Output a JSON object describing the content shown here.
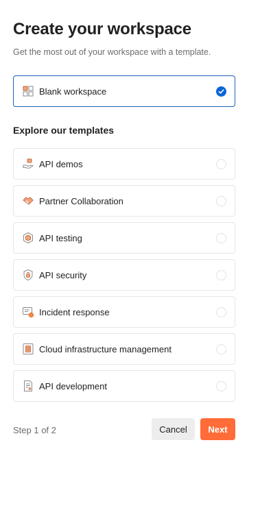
{
  "header": {
    "title": "Create your workspace",
    "subtitle": "Get the most out of your workspace with a template."
  },
  "blank": {
    "label": "Blank workspace",
    "selected": true,
    "icon": "blank-grid-icon"
  },
  "templates": {
    "heading": "Explore our templates",
    "items": [
      {
        "label": "API demos",
        "icon": "hand-box-icon"
      },
      {
        "label": "Partner Collaboration",
        "icon": "handshake-icon"
      },
      {
        "label": "API testing",
        "icon": "hexagon-badge-icon"
      },
      {
        "label": "API security",
        "icon": "shield-lock-icon"
      },
      {
        "label": "Incident response",
        "icon": "alert-message-icon"
      },
      {
        "label": "Cloud infrastructure management",
        "icon": "server-rack-icon"
      },
      {
        "label": "API development",
        "icon": "document-code-icon"
      }
    ]
  },
  "footer": {
    "step": "Step 1 of 2",
    "cancel_label": "Cancel",
    "next_label": "Next"
  },
  "colors": {
    "accent": "#ff6c37",
    "selected_border": "#1d5fb7",
    "check": "#0b65d6"
  }
}
